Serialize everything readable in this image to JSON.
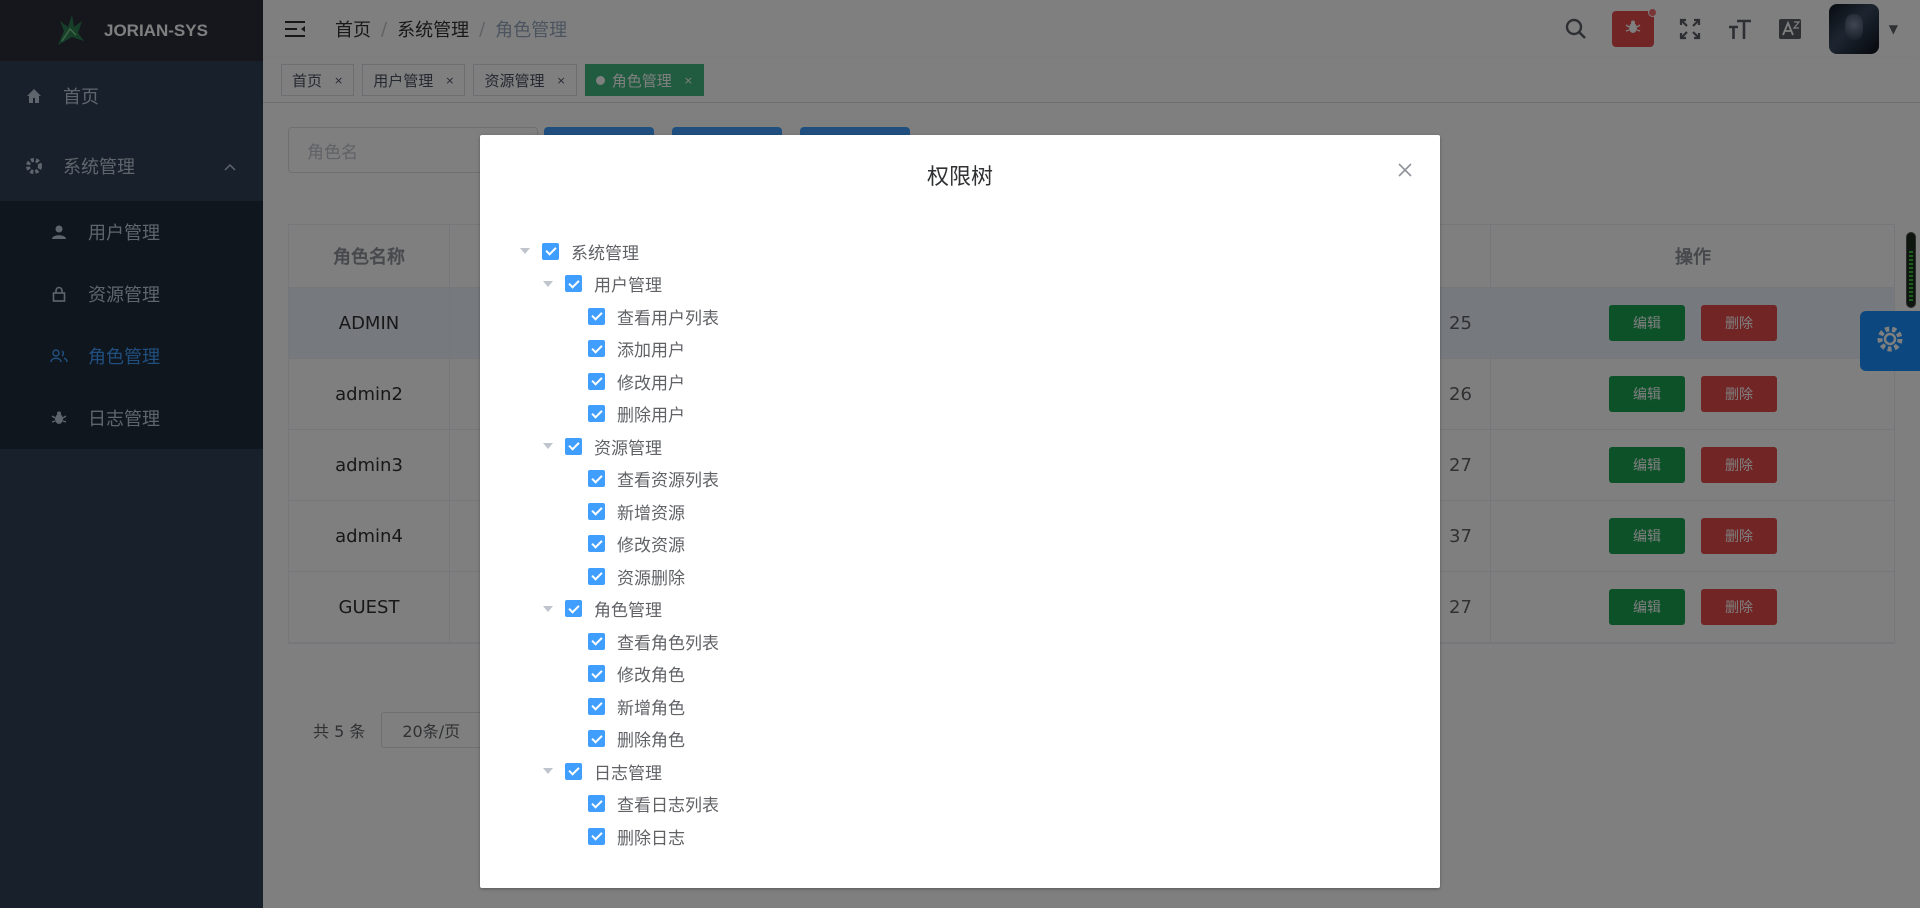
{
  "app": {
    "logo_text": "JORIAN-SYS"
  },
  "sidebar": {
    "items": [
      {
        "label": "首页"
      },
      {
        "label": "系统管理"
      }
    ],
    "submenu": [
      {
        "label": "用户管理"
      },
      {
        "label": "资源管理"
      },
      {
        "label": "角色管理"
      },
      {
        "label": "日志管理"
      }
    ]
  },
  "breadcrumb": [
    "首页",
    "系统管理",
    "角色管理"
  ],
  "breadcrumb_sep": "/",
  "tags": [
    {
      "label": "首页"
    },
    {
      "label": "用户管理"
    },
    {
      "label": "资源管理"
    },
    {
      "label": "角色管理"
    }
  ],
  "tag_close": "×",
  "search": {
    "placeholder": "角色名"
  },
  "table": {
    "headers": {
      "name": "角色名称",
      "ops": "操作"
    },
    "rows": [
      {
        "name": "ADMIN",
        "time_tail": "25"
      },
      {
        "name": "admin2",
        "time_tail": "26"
      },
      {
        "name": "admin3",
        "time_tail": "27"
      },
      {
        "name": "admin4",
        "time_tail": "37"
      },
      {
        "name": "GUEST",
        "time_tail": "27"
      }
    ],
    "edit_label": "编辑",
    "delete_label": "删除"
  },
  "pager": {
    "total": "共 5 条",
    "page_size": "20条/页"
  },
  "dialog": {
    "title": "权限树",
    "tree": [
      {
        "label": "系统管理"
      },
      {
        "label": "用户管理"
      },
      {
        "label": "查看用户列表"
      },
      {
        "label": "添加用户"
      },
      {
        "label": "修改用户"
      },
      {
        "label": "删除用户"
      },
      {
        "label": "资源管理"
      },
      {
        "label": "查看资源列表"
      },
      {
        "label": "新增资源"
      },
      {
        "label": "修改资源"
      },
      {
        "label": "资源删除"
      },
      {
        "label": "角色管理"
      },
      {
        "label": "查看角色列表"
      },
      {
        "label": "修改角色"
      },
      {
        "label": "新增角色"
      },
      {
        "label": "删除角色"
      },
      {
        "label": "日志管理"
      },
      {
        "label": "查看日志列表"
      },
      {
        "label": "删除日志"
      }
    ]
  },
  "colors": {
    "sidebar_bg": "#304156",
    "active_tag": "#42b983",
    "primary": "#409eff",
    "edit": "#1aa352",
    "danger": "#e34b4b"
  }
}
